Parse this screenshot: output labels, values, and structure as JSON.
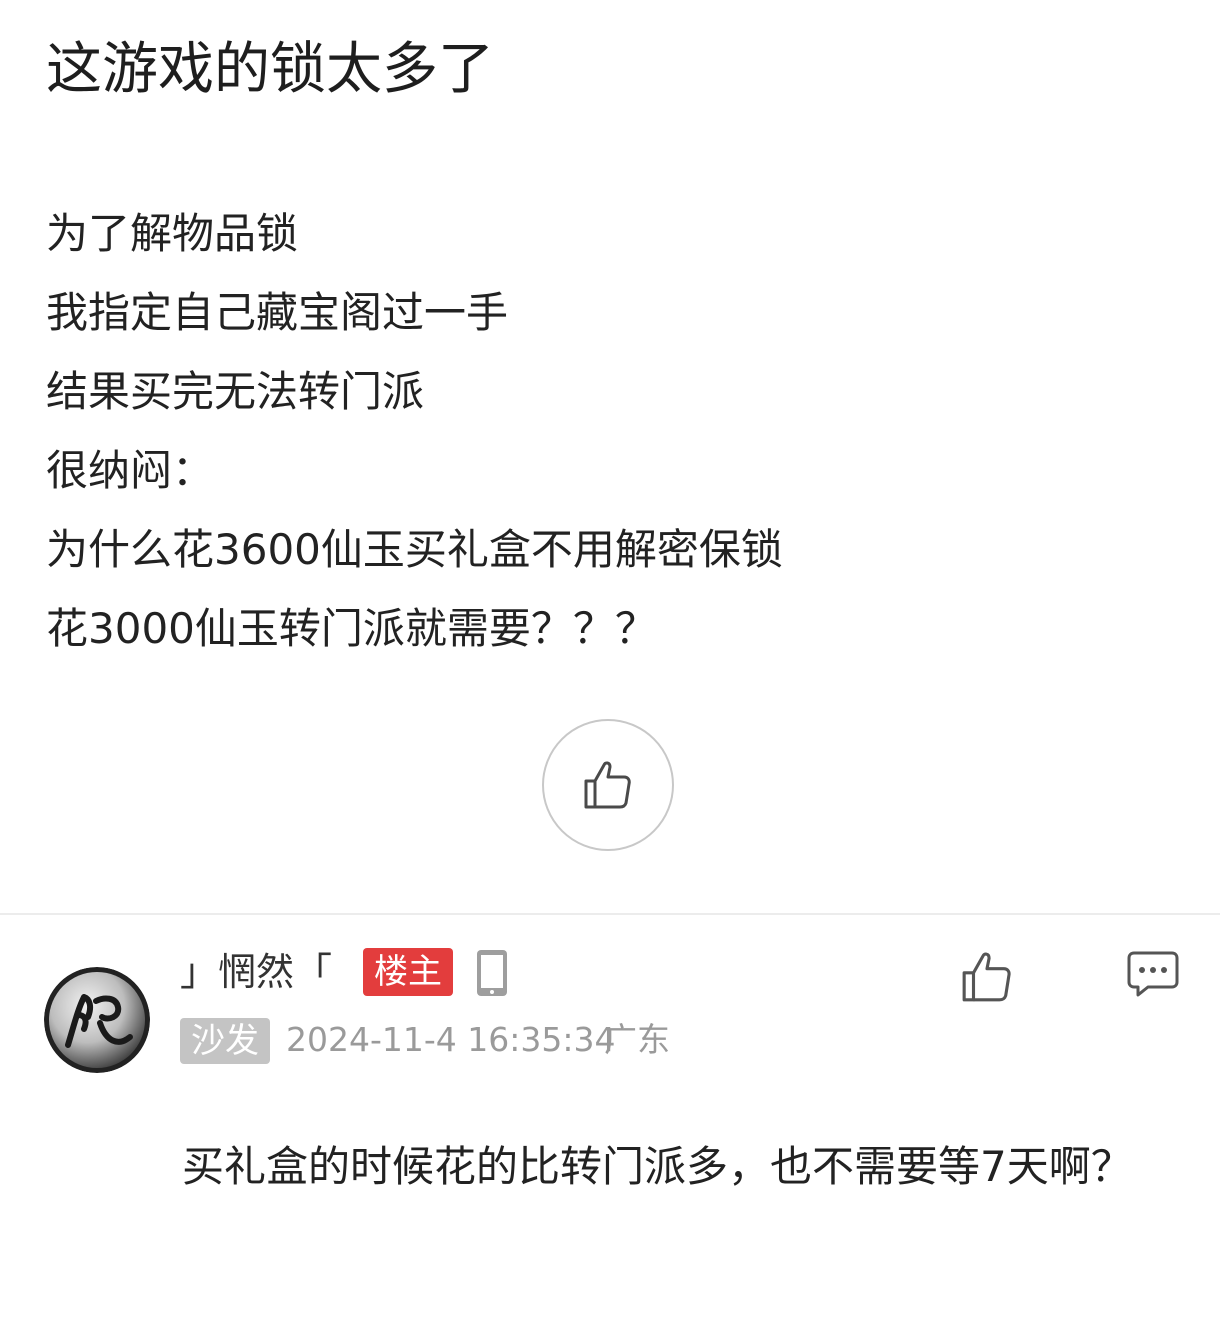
{
  "post": {
    "title": "这游戏的锁太多了",
    "lines": [
      "为了解物品锁",
      "我指定自己藏宝阁过一手",
      "结果买完无法转门派",
      "很纳闷：",
      "为什么花3600仙玉买礼盒不用解密保锁",
      "花3000仙玉转门派就需要？？？"
    ],
    "like_icon": "thumbs-up-icon"
  },
  "reply": {
    "avatar_icon": "avatar-image",
    "username": "」惘然「",
    "op_badge": "楼主",
    "device_icon": "phone-icon",
    "floor_badge": "沙发",
    "timestamp": "2024-11-4 16:35:34",
    "location": "广东",
    "like_icon": "thumbs-up-icon",
    "comment_icon": "comment-icon",
    "text": "买礼盒的时候花的比转门派多，也不需要等7天啊？"
  },
  "colors": {
    "op_badge_bg": "#e33d3d",
    "floor_badge_bg": "#c4c4c4",
    "meta_text": "#9a9a9a",
    "divider": "#ececec"
  }
}
